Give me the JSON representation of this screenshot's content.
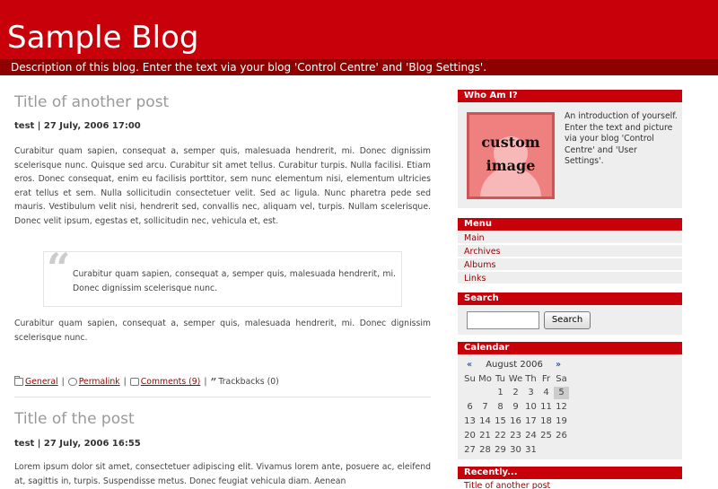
{
  "header": {
    "title": "Sample Blog",
    "description": "Description of this blog. Enter the text via your blog 'Control Centre' and 'Blog Settings'."
  },
  "posts": [
    {
      "title": "Title of another post",
      "meta": "test | 27 July, 2006 17:00",
      "paragraph1": "Curabitur quam sapien, consequat a, semper quis, malesuada hendrerit, mi. Donec dignissim scelerisque nunc. Quisque sed arcu. Curabitur sit amet tellus. Curabitur turpis. Nulla facilisi. Etiam eros. Donec consequat, enim eu facilisis porttitor, sem nunc elementum nisi, elementum ultricies erat tellus et sem. Nulla sollicitudin consectetuer velit. Sed ac ligula. Nunc pharetra pede sed mauris. Vestibulum velit nisi, hendrerit sed, convallis nec, aliquam vel, turpis. Nullam scelerisque. Donec velit ipsum, egestas et, sollicitudin nec, vehicula et, est.",
      "quote": "Curabitur quam sapien, consequat a, semper quis, malesuada hendrerit, mi. Donec dignissim scelerisque nunc.",
      "paragraph2": "Curabitur quam sapien, consequat a, semper quis, malesuada hendrerit, mi. Donec dignissim scelerisque nunc.",
      "footer": {
        "category": "General",
        "permalink": "Permalink",
        "comments": "Comments (9)",
        "trackbacks": "Trackbacks (0)",
        "separator": "|"
      }
    },
    {
      "title": "Title of the post",
      "meta": "test | 27 July, 2006 16:55",
      "paragraph1": "Lorem ipsum dolor sit amet, consectetuer adipiscing elit. Vivamus lorem ante, posuere ac, eleifend at, sagittis in, turpis. Suspendisse metus. Donec feugiat vehicula diam. Aenean"
    }
  ],
  "sidebar": {
    "about": {
      "heading": "Who Am I?",
      "image_text_1": "custom",
      "image_text_2": "image",
      "text": "An introduction of yourself. Enter the text and picture via your blog 'Control Centre' and 'User Settings'."
    },
    "menu": {
      "heading": "Menu",
      "items": [
        "Main",
        "Archives",
        "Albums",
        "Links"
      ]
    },
    "search": {
      "heading": "Search",
      "input_value": "",
      "button_label": "Search"
    },
    "calendar": {
      "heading": "Calendar",
      "prev": "«",
      "next": "»",
      "month": "August 2006",
      "weekdays": [
        "Su",
        "Mo",
        "Tu",
        "We",
        "Th",
        "Fr",
        "Sa"
      ],
      "weeks": [
        [
          "",
          "",
          "1",
          "2",
          "3",
          "4",
          "5"
        ],
        [
          "6",
          "7",
          "8",
          "9",
          "10",
          "11",
          "12"
        ],
        [
          "13",
          "14",
          "15",
          "16",
          "17",
          "18",
          "19"
        ],
        [
          "20",
          "21",
          "22",
          "23",
          "24",
          "25",
          "26"
        ],
        [
          "27",
          "28",
          "29",
          "30",
          "31",
          "",
          ""
        ]
      ],
      "highlighted_day": "5"
    },
    "recent": {
      "heading": "Recently...",
      "items": [
        "Title of another post"
      ]
    }
  },
  "colors": {
    "header_red": "#c8000a",
    "description_bar": "#8f0000",
    "link": "#990000",
    "post_title": "#999999"
  }
}
